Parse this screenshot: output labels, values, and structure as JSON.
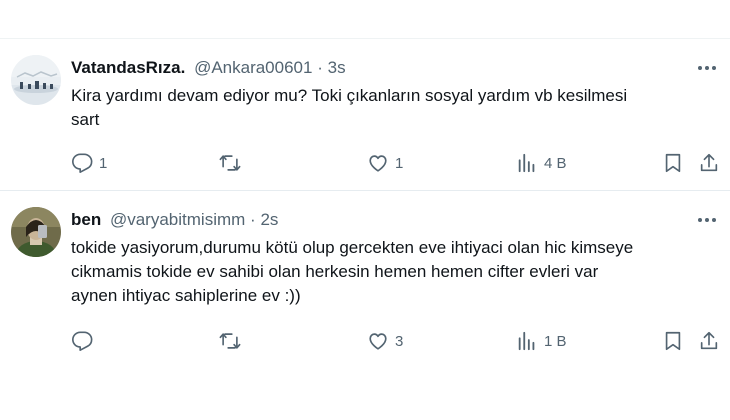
{
  "colors": {
    "text": "#0f1419",
    "secondary": "#536471",
    "divider": "#eff3f4"
  },
  "tweets": [
    {
      "display_name": "VatandasRıza.",
      "handle": "@Ankara00601",
      "separator": "·",
      "time": "3s",
      "text": "Kira yardımı devam ediyor mu? Toki çıkanların sosyal yardım vb kesilmesi\nsart",
      "avatar": "snowy-landscape",
      "actions": {
        "replies": "1",
        "reposts": "",
        "likes": "1",
        "views": "4 B"
      }
    },
    {
      "display_name": "ben",
      "handle": "@varyabitmisimm",
      "separator": "·",
      "time": "2s",
      "text": "tokide yasiyorum,durumu kötü olup gercekten eve ihtiyaci olan hic kimseye\ncikmamis tokide ev sahibi olan herkesin hemen hemen cifter evleri var\naynen ihtiyac sahiplerine ev :))",
      "avatar": "person-photo",
      "actions": {
        "replies": "",
        "reposts": "",
        "likes": "3",
        "views": "1 B"
      }
    }
  ],
  "icons": {
    "reply": "reply-icon",
    "repost": "repost-icon",
    "like": "like-icon",
    "views": "views-icon",
    "bookmark": "bookmark-icon",
    "share": "share-icon",
    "more": "more-icon"
  }
}
